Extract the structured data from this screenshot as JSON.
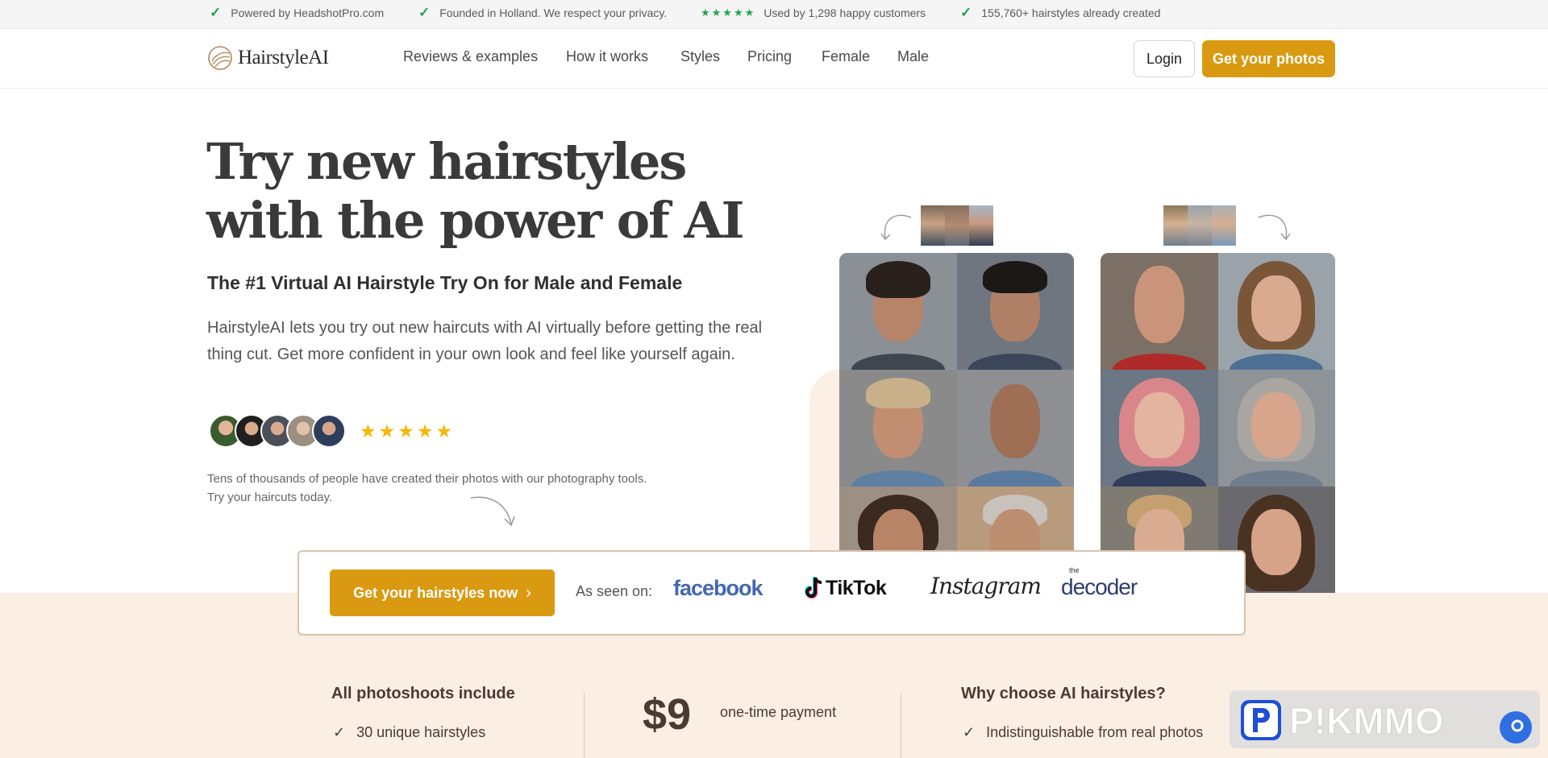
{
  "topbar": {
    "items": [
      {
        "check": "✓",
        "text": "Powered by HeadshotPro.com"
      },
      {
        "check": "✓",
        "text": "Founded in Holland. We respect your privacy."
      },
      {
        "stars": "★★★★★",
        "text": "Used by 1,298 happy customers"
      },
      {
        "check": "✓",
        "text": "155,760+ hairstyles already created"
      }
    ]
  },
  "nav": {
    "logo": "HairstyleAI",
    "links": [
      "Reviews & examples",
      "How it works",
      "Styles",
      "Pricing",
      "Female",
      "Male"
    ],
    "login": "Login",
    "get_photos": "Get your photos"
  },
  "hero": {
    "title_line1": "Try new hairstyles",
    "title_line2": "with the power of AI",
    "subtitle": "The #1 Virtual AI Hairstyle Try On for Male and Female",
    "paragraph": "HairstyleAI lets you try out new haircuts with AI virtually before getting the real thing cut. Get more confident in your own look and feel like yourself again.",
    "stars": "★★★★★",
    "social_proof": "Tens of thousands of people have created their photos with our photography tools. Try your haircuts today."
  },
  "strip": {
    "cta": "Get your hairstyles now",
    "cta_chevron": "›",
    "seen_on": "As seen on:",
    "brands": [
      "facebook",
      "TikTok",
      "Instagram",
      "the",
      "decoder"
    ]
  },
  "bottom": {
    "col1_title": "All photoshoots include",
    "col1_item": "30 unique hairstyles",
    "price": "$9",
    "price_note": "one-time payment",
    "col3_title": "Why choose AI hairstyles?",
    "col3_item": "Indistinguishable from real photos",
    "check": "✓"
  },
  "colors": {
    "accent": "#d99a12",
    "check_green": "#22a34a",
    "star_yellow": "#f5b70a",
    "peach": "#fbeee3"
  }
}
